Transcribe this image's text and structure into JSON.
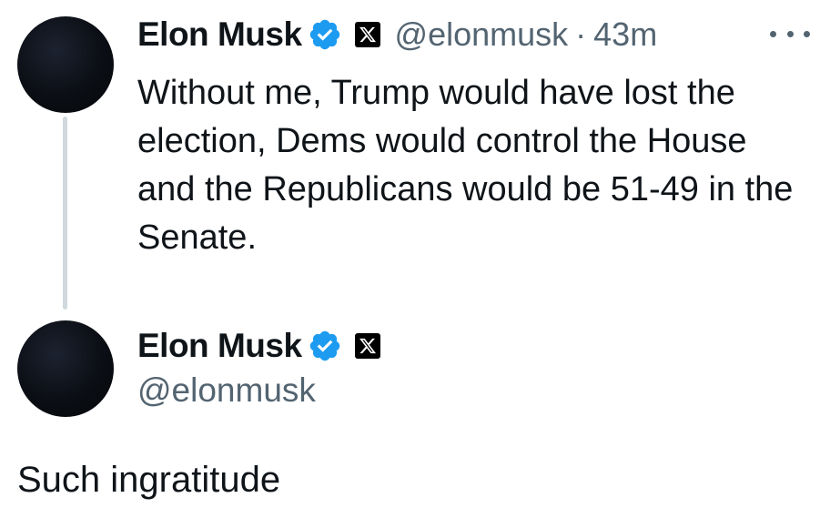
{
  "post": {
    "author_name": "Elon Musk",
    "handle": "@elonmusk",
    "separator": "·",
    "timestamp": "43m",
    "text": "Without me, Trump would have lost the election, Dems would control the House and the Republicans would be 51-49 in the Senate.",
    "badges": [
      "verified-check-icon",
      "x-logo-icon"
    ],
    "more_icon": "more-horizontal-icon"
  },
  "reply": {
    "author_name": "Elon Musk",
    "handle": "@elonmusk",
    "badges": [
      "verified-check-icon",
      "x-logo-icon"
    ],
    "text": "Such ingratitude"
  },
  "colors": {
    "text_primary": "#0f1419",
    "text_secondary": "#536471",
    "verified_blue": "#1d9bf0",
    "thread_line": "#cfd9de"
  }
}
